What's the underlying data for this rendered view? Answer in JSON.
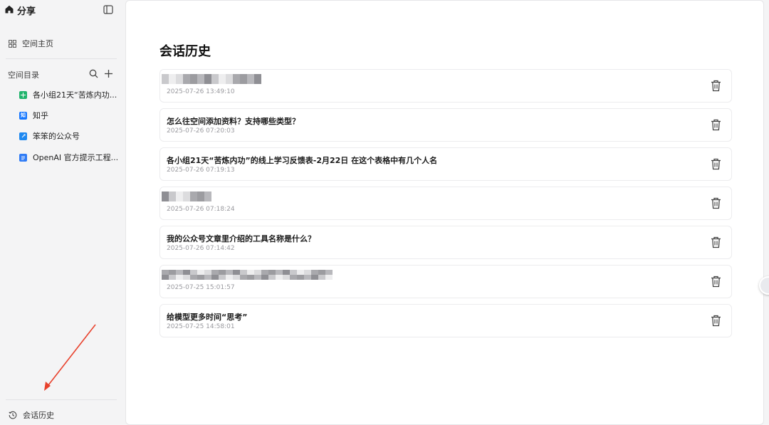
{
  "sidebar": {
    "title": "分享",
    "home_link": "空间主页",
    "directory_label": "空间目录",
    "items": [
      {
        "label": "各小组21天“苦炼内功...",
        "icon": "sheet-icon",
        "color": "#1fb36b"
      },
      {
        "label": "知乎",
        "icon": "zhihu-icon",
        "color": "#1677ff",
        "glyph": "知"
      },
      {
        "label": "笨笨的公众号",
        "icon": "link-icon",
        "color": "#1e88f0"
      },
      {
        "label": "OpenAI 官方提示工程...",
        "icon": "doc-icon",
        "color": "#2f7bf5"
      }
    ],
    "history_link": "会话历史"
  },
  "main": {
    "title": "会话历史",
    "conversations": [
      {
        "title": "",
        "time": "2025-07-26 13:49:10",
        "redacted": true
      },
      {
        "title": "怎么往空间添加资料？支持哪些类型？",
        "time": "2025-07-26 07:20:03",
        "redacted": false
      },
      {
        "title": "各小组21天“苦炼内功”的线上学习反馈表-2月22日 在这个表格中有几个人名",
        "time": "2025-07-26 07:19:13",
        "redacted": false
      },
      {
        "title": "",
        "time": "2025-07-26 07:18:24",
        "redacted": true
      },
      {
        "title": "我的公众号文章里介绍的工具名称是什么？",
        "time": "2025-07-26 07:14:42",
        "redacted": false
      },
      {
        "title": "",
        "time": "2025-07-25 15:01:57",
        "redacted": true
      },
      {
        "title": "给模型更多时间“思考”",
        "time": "2025-07-25 14:58:01",
        "redacted": false
      }
    ]
  },
  "colors": {
    "annotation_arrow": "#e8412c",
    "sidebar_bg": "#f4f4f5",
    "card_border": "#ececee"
  }
}
